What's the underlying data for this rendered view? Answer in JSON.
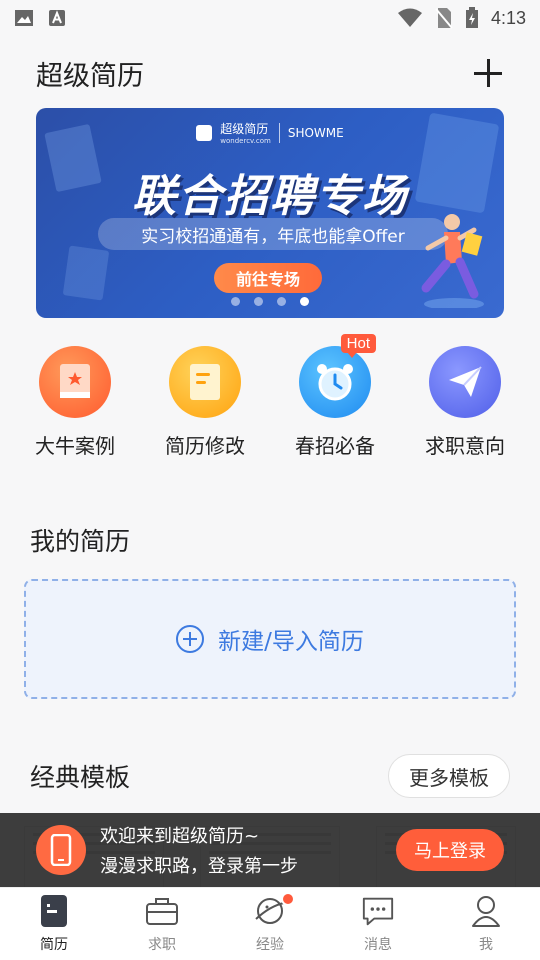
{
  "status_bar": {
    "time": "4:13"
  },
  "header": {
    "title": "超级简历"
  },
  "banner": {
    "brand": "超级简历",
    "brand_domain": "wondercv.com",
    "partner": "SHOWME",
    "headline": "联合招聘专场",
    "subtitle": "实习校招通通有，年底也能拿Offer",
    "cta": "前往专场",
    "slide_count": 4,
    "active_slide": 4
  },
  "shortcuts": [
    {
      "label": "大牛案例",
      "icon": "book-star-icon",
      "color": "#ff6a3d"
    },
    {
      "label": "简历修改",
      "icon": "document-icon",
      "color": "#ffb21e"
    },
    {
      "label": "春招必备",
      "icon": "alarm-clock-icon",
      "color": "#2e9bf0",
      "badge": "Hot"
    },
    {
      "label": "求职意向",
      "icon": "paper-plane-icon",
      "color": "#5b6cf0"
    }
  ],
  "my_resume": {
    "title": "我的简历",
    "new_label": "新建/导入简历"
  },
  "templates": {
    "title": "经典模板",
    "more_label": "更多模板"
  },
  "login_prompt": {
    "line1": "欢迎来到超级简历~",
    "line2": "漫漫求职路，登录第一步",
    "button": "马上登录"
  },
  "tabs": [
    {
      "label": "简历",
      "icon": "resume-icon",
      "active": true
    },
    {
      "label": "求职",
      "icon": "briefcase-icon"
    },
    {
      "label": "经验",
      "icon": "planet-icon",
      "badge": true
    },
    {
      "label": "消息",
      "icon": "chat-icon"
    },
    {
      "label": "我",
      "icon": "person-icon"
    }
  ]
}
